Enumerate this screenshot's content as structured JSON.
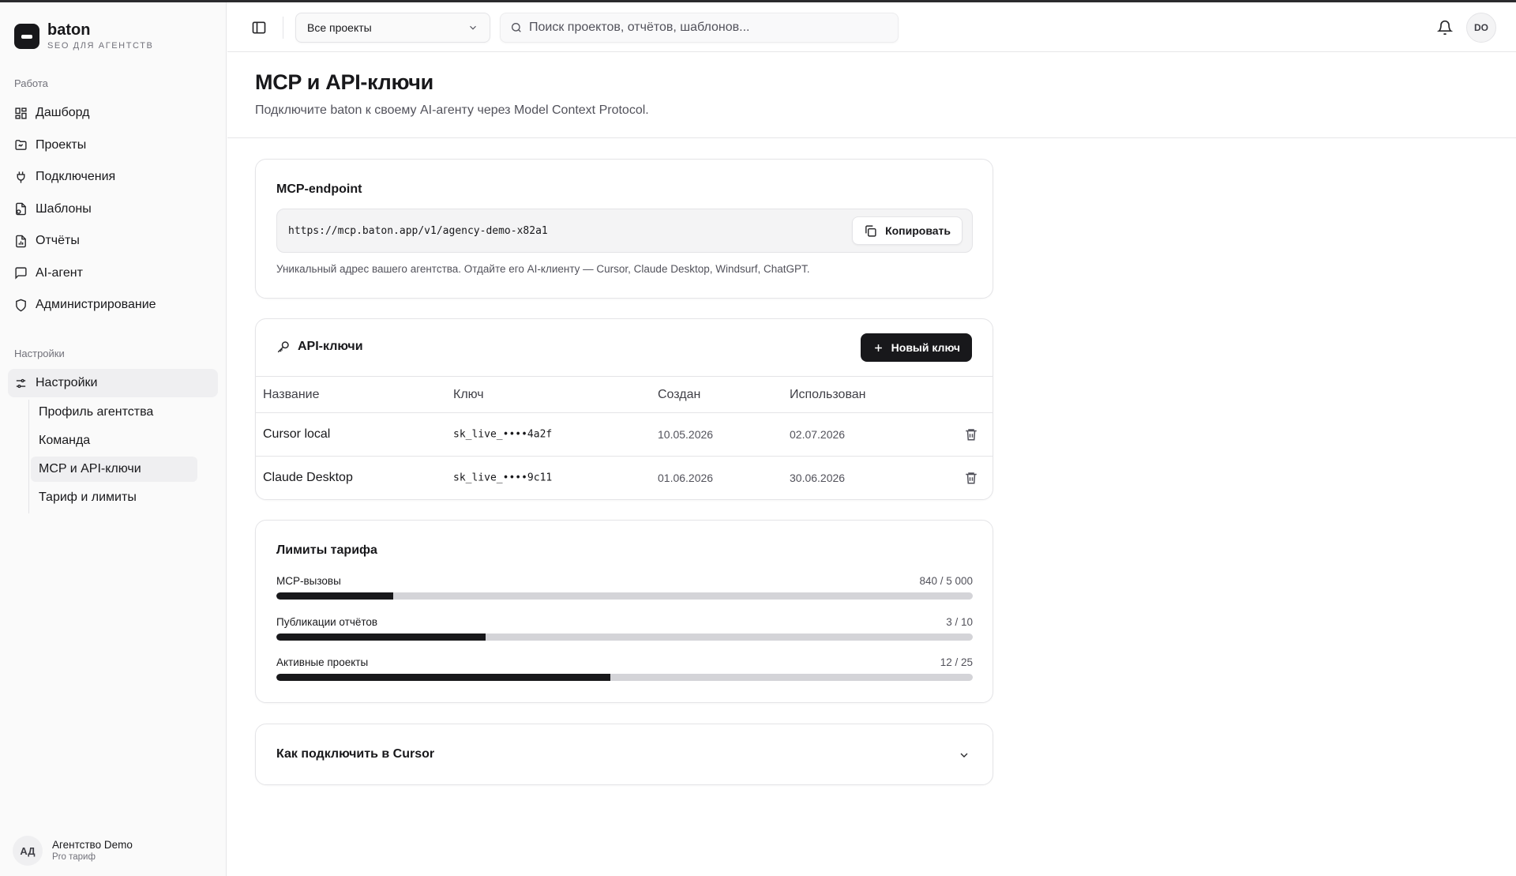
{
  "brand": {
    "name": "baton",
    "subtitle": "SEO ДЛЯ АГЕНТСТВ"
  },
  "sidebar": {
    "section_work": "Работа",
    "work_items": [
      {
        "label": "Дашборд",
        "icon": "dashboard-icon"
      },
      {
        "label": "Проекты",
        "icon": "folder-icon"
      },
      {
        "label": "Подключения",
        "icon": "plug-icon"
      },
      {
        "label": "Шаблоны",
        "icon": "template-icon"
      },
      {
        "label": "Отчёты",
        "icon": "report-icon"
      },
      {
        "label": "AI-агент",
        "icon": "chat-icon"
      },
      {
        "label": "Администрирование",
        "icon": "shield-icon"
      }
    ],
    "section_settings": "Настройки",
    "settings_item": {
      "label": "Настройки",
      "icon": "settings-sliders-icon"
    },
    "settings_sub": [
      "Профиль агентства",
      "Команда",
      "MCP и API-ключи",
      "Тариф и лимиты"
    ],
    "account": {
      "initials": "АД",
      "name": "Агентство Demo",
      "plan": "Pro тариф"
    }
  },
  "topbar": {
    "project_select": "Все проекты",
    "search_placeholder": "Поиск проектов, отчётов, шаблонов...",
    "user_initials": "DO"
  },
  "page": {
    "title": "MCP и API-ключи",
    "description": "Подключите baton к своему AI-агенту через Model Context Protocol."
  },
  "endpoint": {
    "title": "MCP-endpoint",
    "url": "https://mcp.baton.app/v1/agency-demo-x82a1",
    "copy_label": "Копировать",
    "hint": "Уникальный адрес вашего агентства. Отдайте его AI-клиенту — Cursor, Claude Desktop, Windsurf, ChatGPT."
  },
  "keys": {
    "title": "API-ключи",
    "new_label": "Новый ключ",
    "columns": [
      "Название",
      "Ключ",
      "Создан",
      "Использован"
    ],
    "rows": [
      {
        "name": "Cursor local",
        "key": "sk_live_••••4a2f",
        "created": "10.05.2026",
        "used": "02.07.2026"
      },
      {
        "name": "Claude Desktop",
        "key": "sk_live_••••9c11",
        "created": "01.06.2026",
        "used": "30.06.2026"
      }
    ]
  },
  "limits": {
    "title": "Лимиты тарифа",
    "items": [
      {
        "label": "MCP-вызовы",
        "value": "840 / 5 000",
        "fraction": 0.168
      },
      {
        "label": "Публикации отчётов",
        "value": "3 / 10",
        "fraction": 0.3
      },
      {
        "label": "Активные проекты",
        "value": "12 / 25",
        "fraction": 0.48
      }
    ]
  },
  "howto": {
    "title": "Как подключить в Cursor"
  },
  "colors": {
    "accent": "#18181b",
    "muted": "#71717a",
    "border": "#e4e4e7",
    "track": "#d4d4d8"
  }
}
